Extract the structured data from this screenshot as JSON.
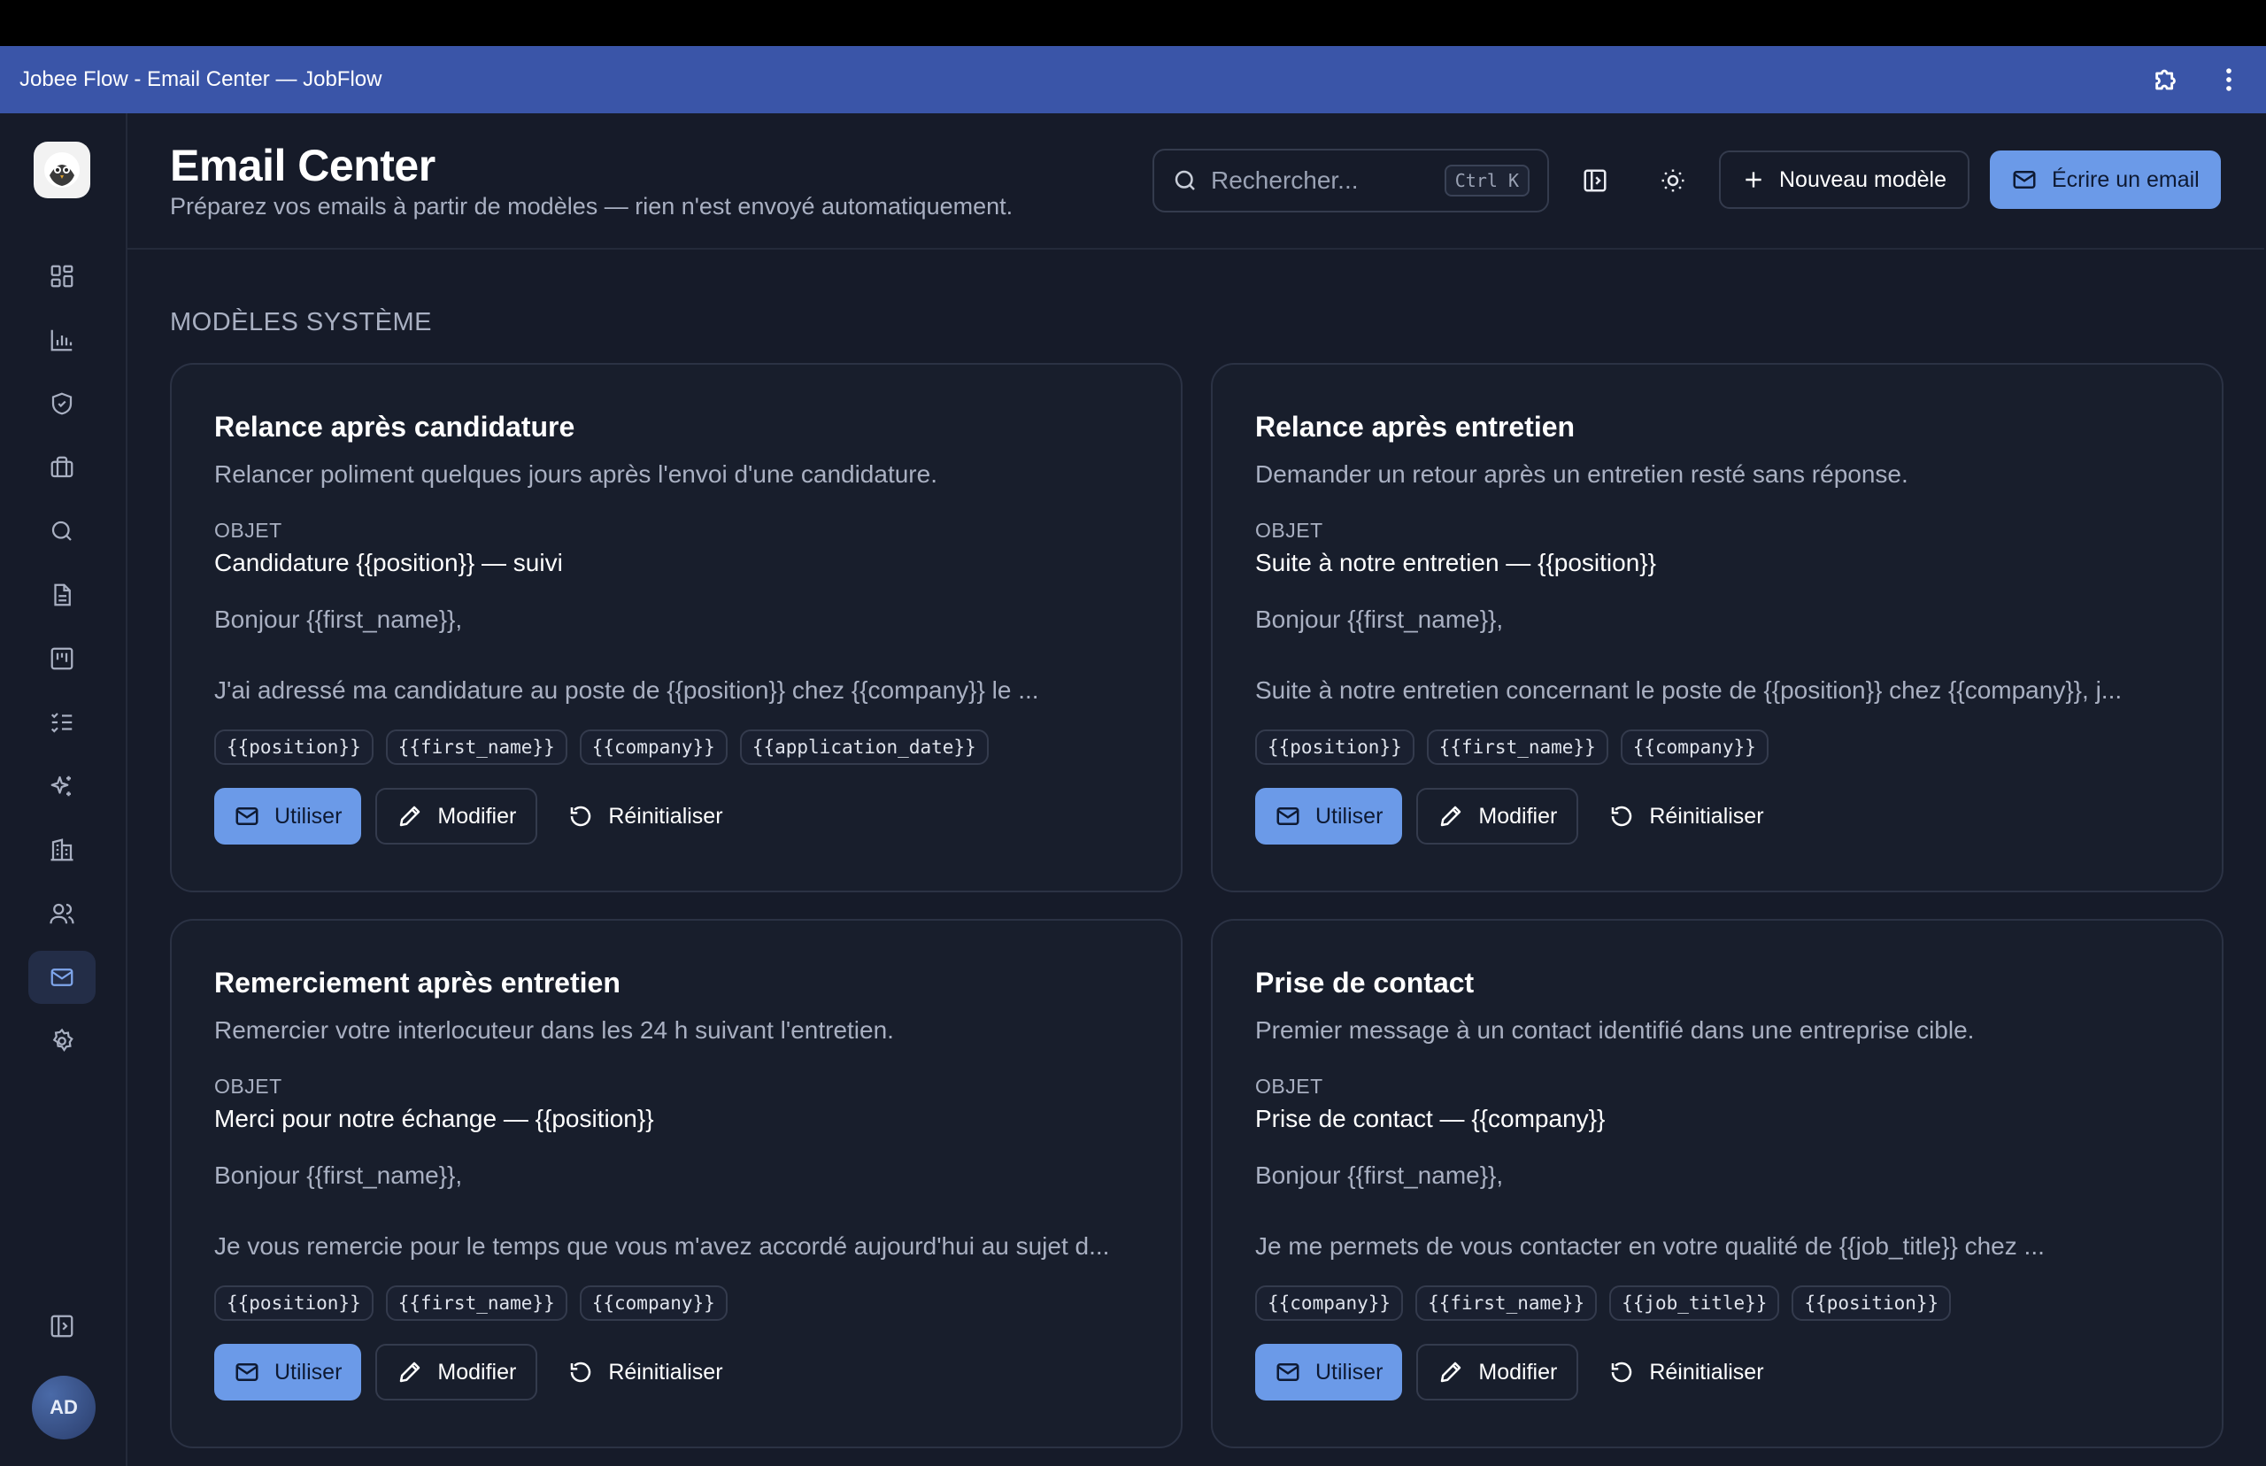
{
  "window": {
    "title": "Jobee Flow - Email Center — JobFlow"
  },
  "sidebar": {
    "items": [
      {
        "icon": "dashboard-icon"
      },
      {
        "icon": "bar-chart-icon"
      },
      {
        "icon": "shield-check-icon"
      },
      {
        "icon": "briefcase-icon"
      },
      {
        "icon": "search-icon"
      },
      {
        "icon": "document-icon"
      },
      {
        "icon": "kanban-icon"
      },
      {
        "icon": "checklist-icon"
      },
      {
        "icon": "sparkles-icon"
      },
      {
        "icon": "building-icon"
      },
      {
        "icon": "users-icon"
      },
      {
        "icon": "mail-icon",
        "active": true
      },
      {
        "icon": "gear-icon"
      }
    ],
    "avatar_initials": "AD"
  },
  "header": {
    "title": "Email Center",
    "subtitle": "Préparez vos emails à partir de modèles — rien n'est envoyé automatiquement.",
    "search_placeholder": "Rechercher...",
    "search_shortcut": "Ctrl K",
    "new_template_label": "Nouveau modèle",
    "compose_label": "Écrire un email"
  },
  "section": {
    "label": "MODÈLES SYSTÈME"
  },
  "card_labels": {
    "object": "OBJET",
    "use": "Utiliser",
    "edit": "Modifier",
    "reset": "Réinitialiser"
  },
  "templates": [
    {
      "title": "Relance après candidature",
      "description": "Relancer poliment quelques jours après l'envoi d'une candidature.",
      "subject": "Candidature {{position}} — suivi",
      "greeting": "Bonjour {{first_name}},",
      "body": "J'ai adressé ma candidature au poste de {{position}} chez {{company}} le ...",
      "tags": [
        "{{position}}",
        "{{first_name}}",
        "{{company}}",
        "{{application_date}}"
      ]
    },
    {
      "title": "Relance après entretien",
      "description": "Demander un retour après un entretien resté sans réponse.",
      "subject": "Suite à notre entretien — {{position}}",
      "greeting": "Bonjour {{first_name}},",
      "body": "Suite à notre entretien concernant le poste de {{position}} chez {{company}}, j...",
      "tags": [
        "{{position}}",
        "{{first_name}}",
        "{{company}}"
      ]
    },
    {
      "title": "Remerciement après entretien",
      "description": "Remercier votre interlocuteur dans les 24 h suivant l'entretien.",
      "subject": "Merci pour notre échange — {{position}}",
      "greeting": "Bonjour {{first_name}},",
      "body": "Je vous remercie pour le temps que vous m'avez accordé aujourd'hui au sujet d...",
      "tags": [
        "{{position}}",
        "{{first_name}}",
        "{{company}}"
      ]
    },
    {
      "title": "Prise de contact",
      "description": "Premier message à un contact identifié dans une entreprise cible.",
      "subject": "Prise de contact — {{company}}",
      "greeting": "Bonjour {{first_name}},",
      "body": "Je me permets de vous contacter en votre qualité de {{job_title}} chez ...",
      "tags": [
        "{{company}}",
        "{{first_name}}",
        "{{job_title}}",
        "{{position}}"
      ]
    }
  ],
  "colors": {
    "titlebar": "#3a55a8",
    "background": "#161b29",
    "accent": "#6b9ae8"
  }
}
